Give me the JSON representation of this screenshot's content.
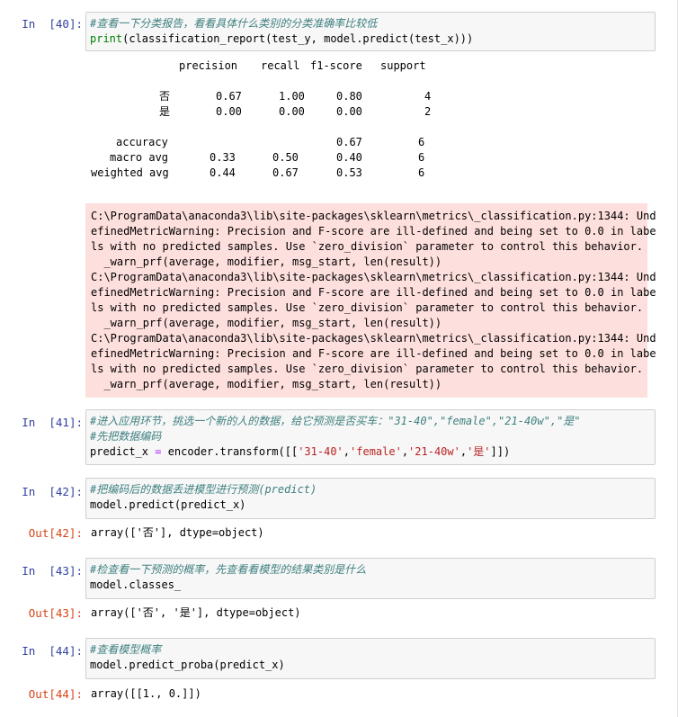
{
  "cells": [
    {
      "prompt": "In  [40]:",
      "code": {
        "comment": "#查看一下分类报告，看看具体什么类别的分类准确率比较低",
        "call_builtin": "print",
        "call_rest": "(classification_report(test_y, model.predict(test_x)))"
      }
    },
    {
      "prompt": "In  [41]:",
      "code": {
        "comment1": "#进入应用环节，挑选一个新的人的数据，给它预测是否买车：\"31-40\",\"female\",\"21-40w\",\"是\"",
        "comment2": "#先把数据编码",
        "line3_a": "predict_x ",
        "line3_eq": "=",
        "line3_b": " encoder.transform([[",
        "s1": "'31-40'",
        "c1": ",",
        "s2": "'female'",
        "c2": ",",
        "s3": "'21-40w'",
        "c3": ",",
        "s4": "'是'",
        "line3_end": "]])"
      }
    },
    {
      "prompt": "In  [42]:",
      "code": {
        "comment": "#把编码后的数据丢进模型进行预测(predict)",
        "line2": "model.predict(predict_x)"
      },
      "out_prompt": "Out[42]:",
      "output": "array(['否'], dtype=object)"
    },
    {
      "prompt": "In  [43]:",
      "code": {
        "comment": "#检查看一下预测的概率，先查看看模型的结果类别是什么",
        "line2": "model.classes_"
      },
      "out_prompt": "Out[43]:",
      "output": "array(['否', '是'], dtype=object)"
    },
    {
      "prompt": "In  [44]:",
      "code": {
        "comment": "#查看模型概率",
        "line2": "model.predict_proba(predict_x)"
      },
      "out_prompt": "Out[44]:",
      "output": "array([[1., 0.]])"
    }
  ],
  "report": {
    "headers": [
      "precision",
      "recall",
      "f1-score",
      "support"
    ],
    "rows": [
      {
        "label": "否",
        "precision": "0.67",
        "recall": "1.00",
        "f1": "0.80",
        "support": "4"
      },
      {
        "label": "是",
        "precision": "0.00",
        "recall": "0.00",
        "f1": "0.00",
        "support": "2"
      }
    ],
    "accuracy": {
      "label": "accuracy",
      "f1": "0.67",
      "support": "6"
    },
    "macro": {
      "label": "macro avg",
      "precision": "0.33",
      "recall": "0.50",
      "f1": "0.40",
      "support": "6"
    },
    "weighted": {
      "label": "weighted avg",
      "precision": "0.44",
      "recall": "0.67",
      "f1": "0.53",
      "support": "6"
    }
  },
  "warnings": [
    "C:\\ProgramData\\anaconda3\\lib\\site-packages\\sklearn\\metrics\\_classification.py:1344: Und",
    "efinedMetricWarning: Precision and F-score are ill-defined and being set to 0.0 in labe",
    "ls with no predicted samples. Use `zero_division` parameter to control this behavior.",
    "  _warn_prf(average, modifier, msg_start, len(result))",
    "C:\\ProgramData\\anaconda3\\lib\\site-packages\\sklearn\\metrics\\_classification.py:1344: Und",
    "efinedMetricWarning: Precision and F-score are ill-defined and being set to 0.0 in labe",
    "ls with no predicted samples. Use `zero_division` parameter to control this behavior.",
    "  _warn_prf(average, modifier, msg_start, len(result))",
    "C:\\ProgramData\\anaconda3\\lib\\site-packages\\sklearn\\metrics\\_classification.py:1344: Und",
    "efinedMetricWarning: Precision and F-score are ill-defined and being set to 0.0 in labe",
    "ls with no predicted samples. Use `zero_division` parameter to control this behavior.",
    "  _warn_prf(average, modifier, msg_start, len(result))"
  ],
  "colors": {
    "in_prompt": "#303F9F",
    "out_prompt": "#D84315",
    "warning_bg": "#fddfdd",
    "input_bg": "#f7f7f7",
    "comment": "#408080",
    "string": "#BA2121",
    "builtin": "#008000"
  }
}
